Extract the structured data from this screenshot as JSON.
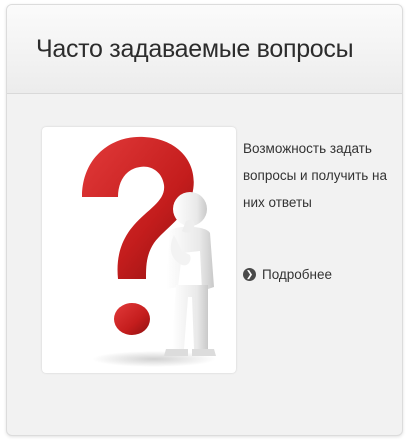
{
  "card": {
    "title": "Часто задаваемые вопросы",
    "image": {
      "icon": "question-mark-thinking-figure-icon"
    },
    "description": "Возможность задать вопросы и получить на них ответы",
    "more_link": {
      "label": "Подробнее",
      "icon": "chevron-right-circle-icon"
    }
  },
  "colors": {
    "card_bg": "#f2f2f2",
    "header_bg": "#f5f5f5",
    "question_mark_red": "#cc1f1f",
    "text": "#333333"
  }
}
